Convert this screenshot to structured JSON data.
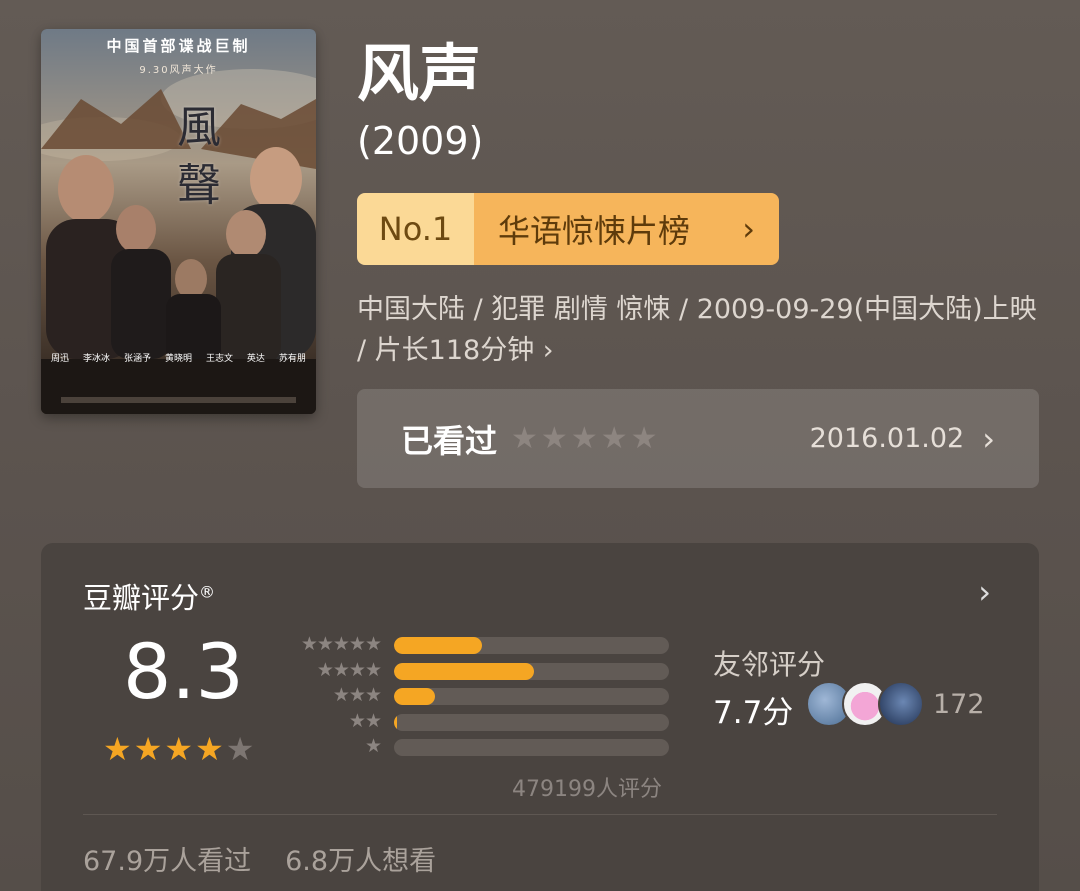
{
  "movie": {
    "title": "风声",
    "year": "(2009)",
    "poster": {
      "tagline": "中国首部谍战巨制",
      "release_note": "9.30风声大作",
      "calligraphy": "風聲",
      "cast": [
        "周迅",
        "李冰冰",
        "张涵予",
        "黄晓明",
        "王志文",
        "英达",
        "苏有朋"
      ]
    },
    "rank": {
      "number": "No.1",
      "list_name": "华语惊悚片榜"
    },
    "meta": "中国大陆 / 犯罪 剧情 惊悚 / 2009-09-29(中国大陆)上映 / 片长118分钟 ›",
    "watched": {
      "label": "已看过",
      "date": "2016.01.02",
      "my_rating": 0
    }
  },
  "rating": {
    "title": "豆瓣评分",
    "reg_mark": "®",
    "score": "8.3",
    "stars": 4,
    "distribution_fractions": [
      0.32,
      0.51,
      0.15,
      0.01,
      0.0
    ],
    "count_text": "479199人评分",
    "friends": {
      "label": "友邻评分",
      "score": "7.7分",
      "count": "172"
    },
    "watched_text": "67.9万人看过",
    "wish_text": "6.8万人想看"
  },
  "colors": {
    "accent_orange": "#f5a623",
    "rank_light": "#fbd996",
    "rank_dark": "#f6b55b"
  },
  "icons": {
    "rank_chevron": "chevron-right-icon",
    "watched_chevron": "chevron-right-icon",
    "card_chevron": "chevron-right-icon"
  }
}
